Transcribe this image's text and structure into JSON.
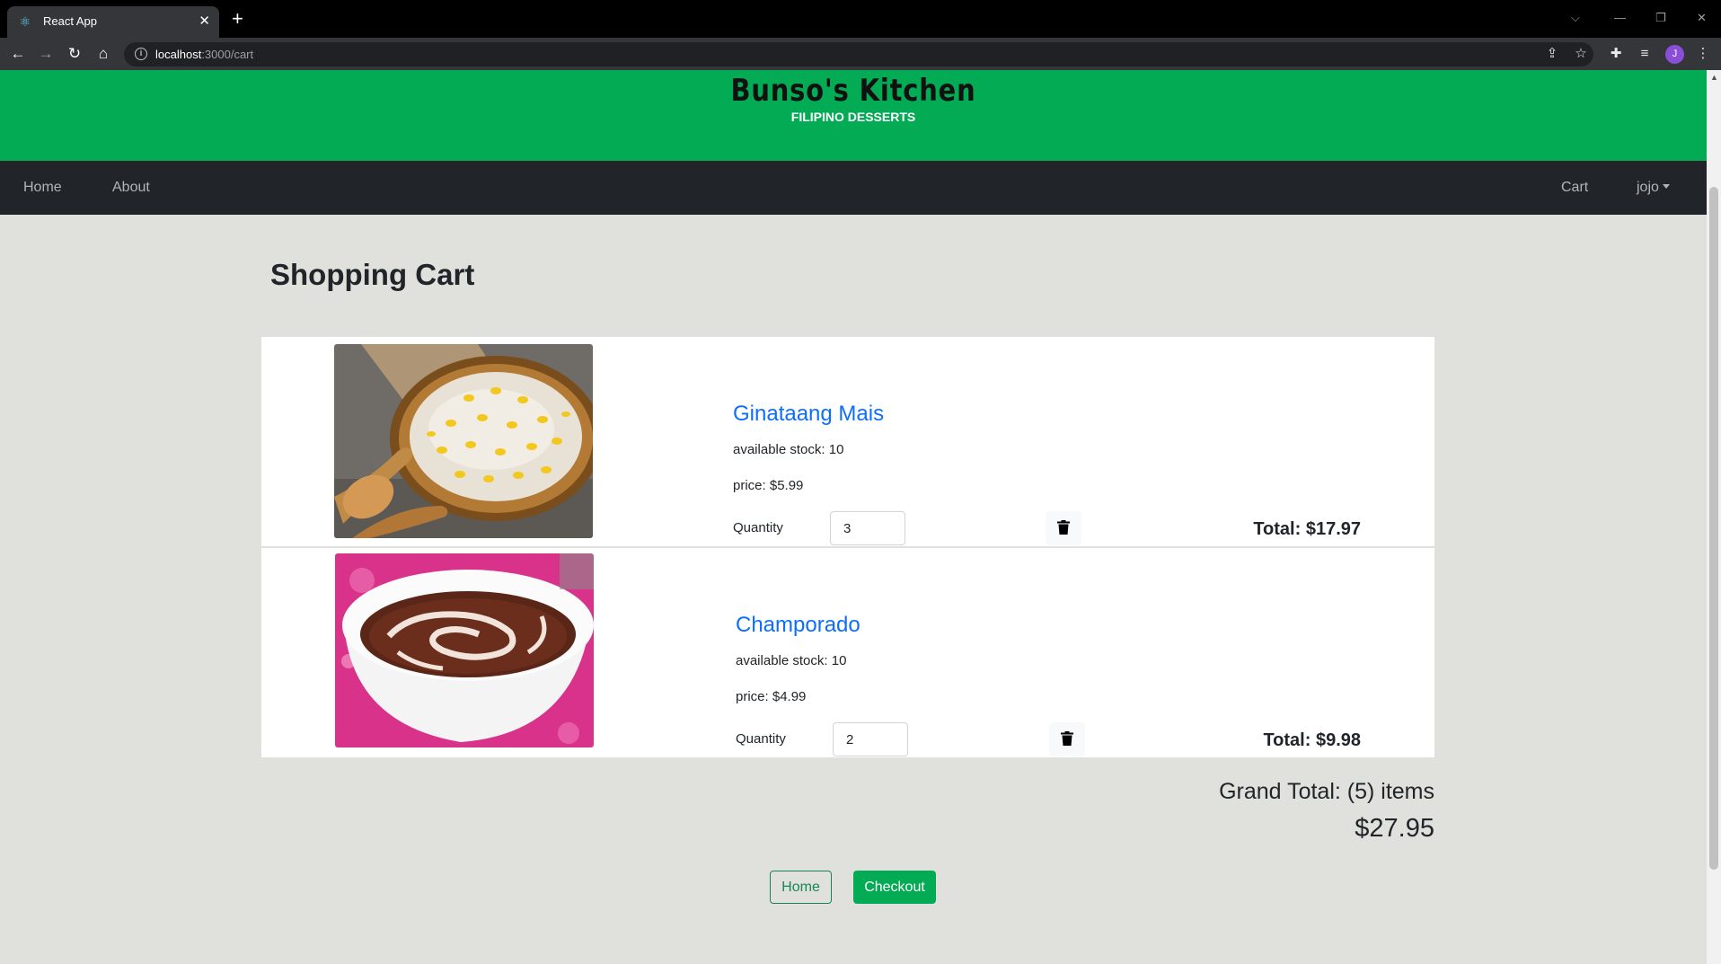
{
  "browser": {
    "tab_title": "React App",
    "url_host": "localhost",
    "url_path": ":3000/cart",
    "profile_initial": "J"
  },
  "brand": {
    "title": "Bunso's Kitchen",
    "subtitle": "FILIPINO DESSERTS",
    "color": "#03ab55"
  },
  "nav": {
    "home": "Home",
    "about": "About",
    "cart": "Cart",
    "user": "jojo"
  },
  "cart": {
    "heading": "Shopping Cart",
    "quantity_label": "Quantity",
    "items": [
      {
        "name": "Ginataang Mais",
        "stock": "available stock: 10",
        "price": "price: $5.99",
        "quantity": "3",
        "total": "Total: $17.97"
      },
      {
        "name": "Champorado",
        "stock": "available stock: 10",
        "price": "price: $4.99",
        "quantity": "2",
        "total": "Total: $9.98"
      }
    ],
    "grand_total_label": "Grand Total: (5) items",
    "grand_total_value": "$27.95",
    "home_button": "Home",
    "checkout_button": "Checkout"
  },
  "icons": {
    "favicon": "react-icon",
    "back": "arrow-left-icon",
    "forward": "arrow-right-icon",
    "reload": "reload-icon",
    "home": "home-icon",
    "site_info": "info-icon",
    "share": "share-icon",
    "bookmark": "star-icon",
    "extensions": "puzzle-icon",
    "reading_list": "media-icon",
    "menu": "kebab-menu-icon",
    "remove_item": "trash-icon"
  }
}
